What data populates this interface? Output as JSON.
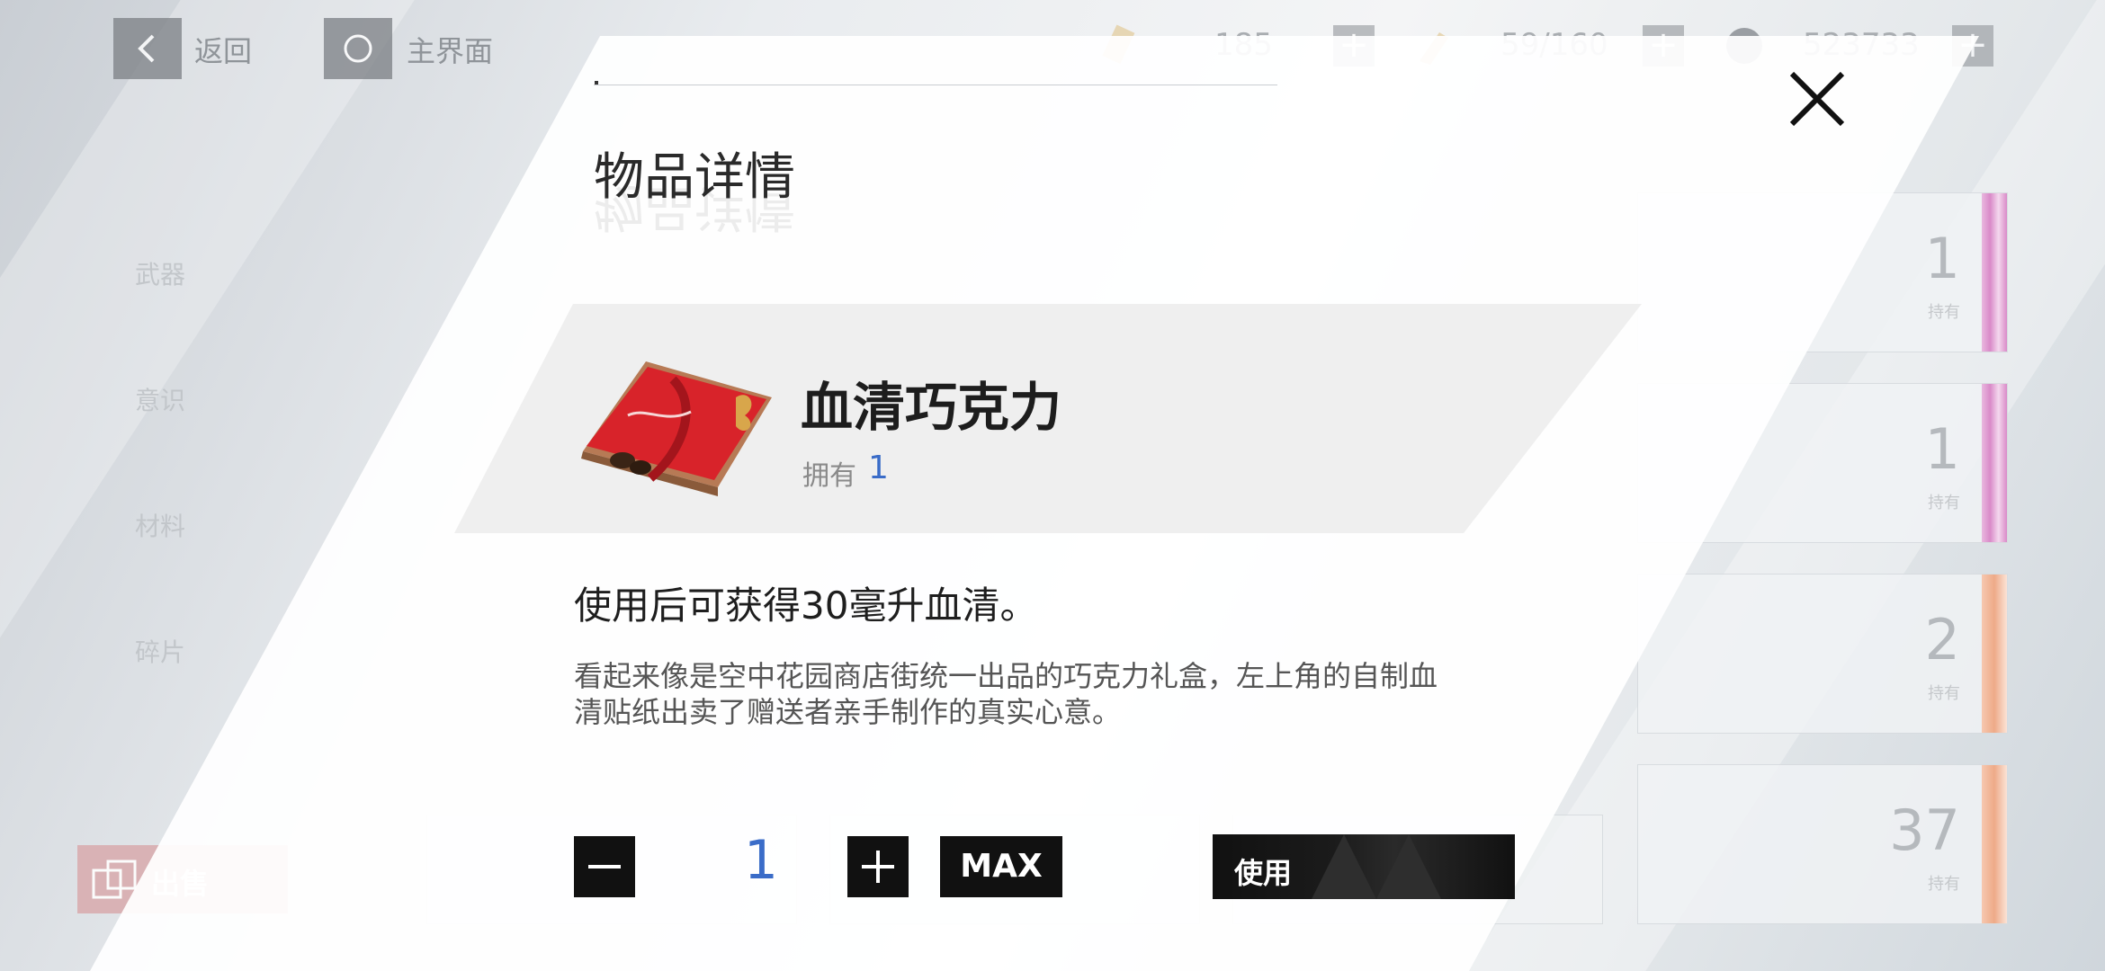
{
  "topbar": {
    "back_label": "返回",
    "home_label": "主界面",
    "resource1_value": "185",
    "resource2_value": "59/160",
    "coin_value": "523733"
  },
  "left_nav": {
    "items": [
      "武器",
      "意识",
      "材料",
      "碎片"
    ],
    "sell_label": "出售"
  },
  "cards": [
    {
      "count": "1",
      "hold_label": "持有",
      "bar_color": "#d98ac8"
    },
    {
      "count": "1",
      "hold_label": "持有",
      "bar_color": "#d98ac8"
    },
    {
      "count": "2",
      "hold_label": "持有",
      "bar_color": "#eeaa88"
    },
    {
      "count": "37",
      "hold_label": "持有",
      "bar_color": "#eeaa88"
    }
  ],
  "modal": {
    "title": "物品详情",
    "item_name": "血清巧克力",
    "own_label": "拥有",
    "own_count": "1",
    "description_main": "使用后可获得30毫升血清。",
    "description_flavor": "看起来像是空中花园商店街统一出品的巧克力礼盒，左上角的自制血清贴纸出卖了赠送者亲手制作的真实心意。",
    "quantity": "1",
    "max_label": "MAX",
    "use_label": "使用"
  }
}
